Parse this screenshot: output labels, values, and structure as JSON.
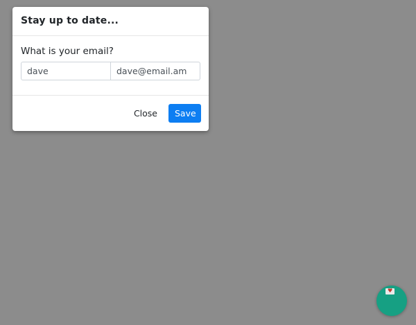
{
  "dialog": {
    "title": "Stay up to date...",
    "prompt": "What is your email?",
    "name_value": "dave",
    "email_value": "dave@email.am",
    "close_label": "Close",
    "save_label": "Save"
  },
  "fab": {
    "icon": "heart-icon"
  },
  "colors": {
    "overlay": "#8c8c8c",
    "primary": "#0d7ef2",
    "fab": "#16a083"
  }
}
